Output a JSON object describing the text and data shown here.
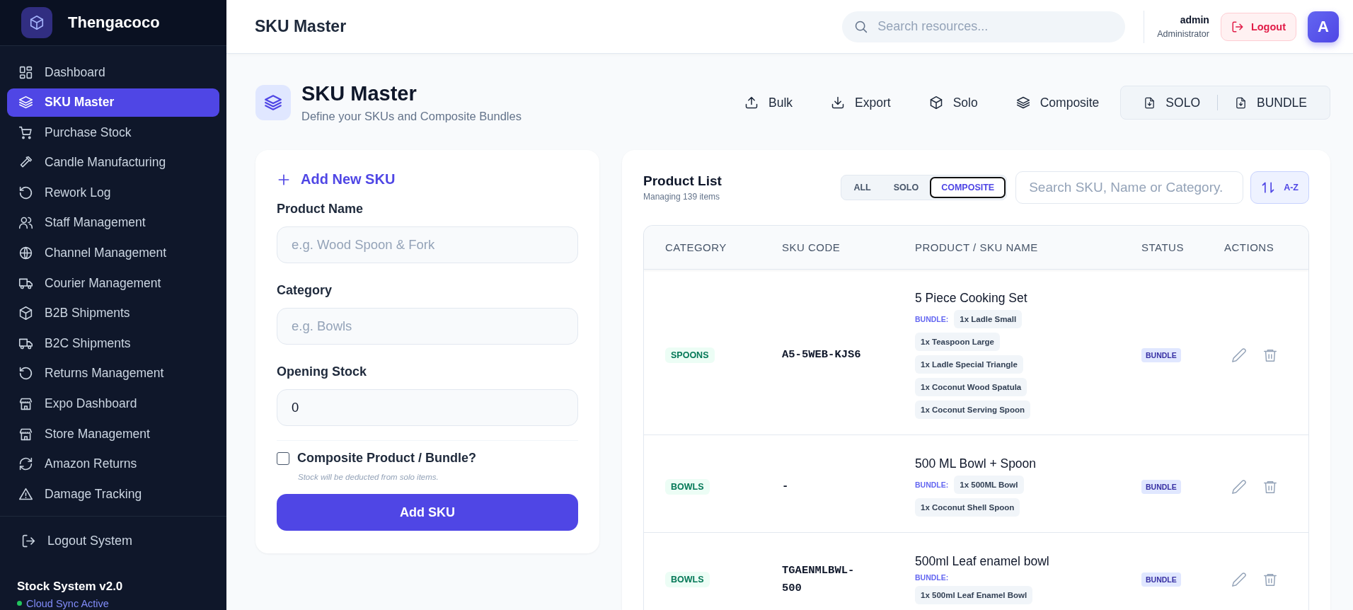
{
  "brand": {
    "name": "Thengacoco"
  },
  "sidebar": {
    "items": [
      {
        "label": "Dashboard",
        "selected": false
      },
      {
        "label": "SKU Master",
        "selected": true
      },
      {
        "label": "Purchase Stock",
        "selected": false
      },
      {
        "label": "Candle Manufacturing",
        "selected": false
      },
      {
        "label": "Rework Log",
        "selected": false
      },
      {
        "label": "Staff Management",
        "selected": false
      },
      {
        "label": "Channel Management",
        "selected": false
      },
      {
        "label": "Courier Management",
        "selected": false
      },
      {
        "label": "B2B Shipments",
        "selected": false
      },
      {
        "label": "B2C Shipments",
        "selected": false
      },
      {
        "label": "Returns Management",
        "selected": false
      },
      {
        "label": "Expo Dashboard",
        "selected": false
      },
      {
        "label": "Store Management",
        "selected": false
      },
      {
        "label": "Amazon Returns",
        "selected": false
      },
      {
        "label": "Damage Tracking",
        "selected": false
      }
    ],
    "logout": "Logout System",
    "version": "Stock System v2.0",
    "sync_status": "Cloud Sync Active"
  },
  "header": {
    "title": "SKU Master",
    "search": {
      "placeholder": "Search resources..."
    },
    "user": {
      "name": "admin",
      "role": "Administrator",
      "avatar": "A"
    },
    "logout": "Logout"
  },
  "page": {
    "title": "SKU Master",
    "subtitle": "Define your SKUs and Composite Bundles",
    "actions": [
      "Bulk",
      "Export",
      "Solo",
      "Composite"
    ],
    "templates": [
      "SOLO",
      "BUNDLE"
    ]
  },
  "form": {
    "title": "Add New SKU",
    "fields": [
      {
        "label": "Product Name",
        "placeholder": "e.g. Wood Spoon & Fork"
      },
      {
        "label": "Category",
        "placeholder": "e.g. Bowls"
      },
      {
        "label": "Opening Stock",
        "value": "0"
      }
    ],
    "composite": {
      "label": "Composite Product / Bundle?",
      "checked": false,
      "hint": "Stock will be deducted from solo items."
    },
    "submit": "Add SKU"
  },
  "product_list": {
    "title": "Product List",
    "subtitle": "Managing 139 items",
    "filters": [
      {
        "label": "ALL",
        "selected": false
      },
      {
        "label": "SOLO",
        "selected": false
      },
      {
        "label": "COMPOSITE",
        "selected": true
      }
    ],
    "search": {
      "placeholder": "Search SKU, Name or Category."
    },
    "sort": "A-Z",
    "table": {
      "columns": [
        "CATEGORY",
        "SKU CODE",
        "PRODUCT / SKU NAME",
        "STATUS",
        "ACTIONS"
      ],
      "rows": [
        {
          "category": "SPOONS",
          "sku_code": "A5-5WEB-KJS6",
          "name": "5 Piece Cooking Set",
          "bundle_label": "BUNDLE:",
          "components": [
            "1x Ladle Small",
            "1x Teaspoon Large",
            "1x Ladle Special Triangle",
            "1x Coconut Wood Spatula",
            "1x Coconut Serving Spoon"
          ],
          "status": "BUNDLE"
        },
        {
          "category": "BOWLS",
          "sku_code": "-",
          "name": "500 ML Bowl + Spoon",
          "bundle_label": "BUNDLE:",
          "components": [
            "1x 500ML Bowl",
            "1x Coconut Shell Spoon"
          ],
          "status": "BUNDLE"
        },
        {
          "category": "BOWLS",
          "sku_code": "TGAENMLBWL-500",
          "name": "500ml Leaf enamel bowl",
          "bundle_label": "BUNDLE:",
          "components": [
            "1x 500ml Leaf Enamel Bowl"
          ],
          "status": "BUNDLE"
        }
      ]
    }
  }
}
